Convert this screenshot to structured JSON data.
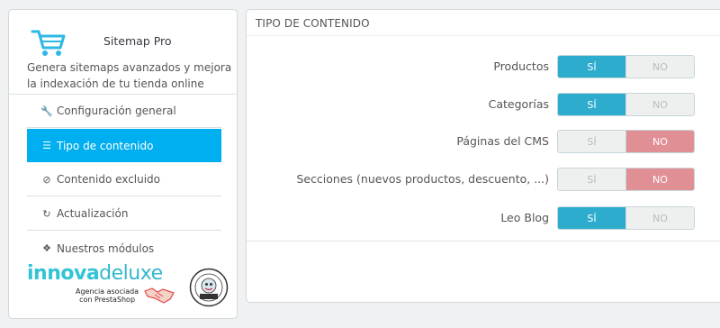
{
  "sidebar": {
    "title": "Sitemap Pro",
    "description": "Genera sitemaps avanzados y mejora la indexación de tu tienda online",
    "menu": [
      {
        "label": "Configuración general",
        "icon": "wrench-icon",
        "active": false
      },
      {
        "label": "Tipo de contenido",
        "icon": "list-icon",
        "active": true
      },
      {
        "label": "Contenido excluido",
        "icon": "ban-icon",
        "active": false
      },
      {
        "label": "Actualización",
        "icon": "refresh-icon",
        "active": false
      },
      {
        "label": "Nuestros módulos",
        "icon": "cubes-icon",
        "active": false
      }
    ],
    "logo": {
      "brand_a": "innova",
      "brand_b": "deluxe",
      "sub_line1": "Agencia asociada",
      "sub_line2": "con PrestaShop"
    }
  },
  "panel": {
    "title": "TIPO DE CONTENIDO",
    "yes_label": "SÍ",
    "no_label": "NO",
    "rows": [
      {
        "label": "Productos",
        "value": "yes"
      },
      {
        "label": "Categorías",
        "value": "yes"
      },
      {
        "label": "Páginas del CMS",
        "value": "no"
      },
      {
        "label": "Secciones (nuevos productos, descuento, ...)",
        "value": "no"
      },
      {
        "label": "Leo Blog",
        "value": "yes"
      }
    ]
  },
  "colors": {
    "active_menu": "#00aff0",
    "switch_yes": "#2eacce",
    "switch_no": "#e08f95",
    "brand": "#33c3d6"
  }
}
